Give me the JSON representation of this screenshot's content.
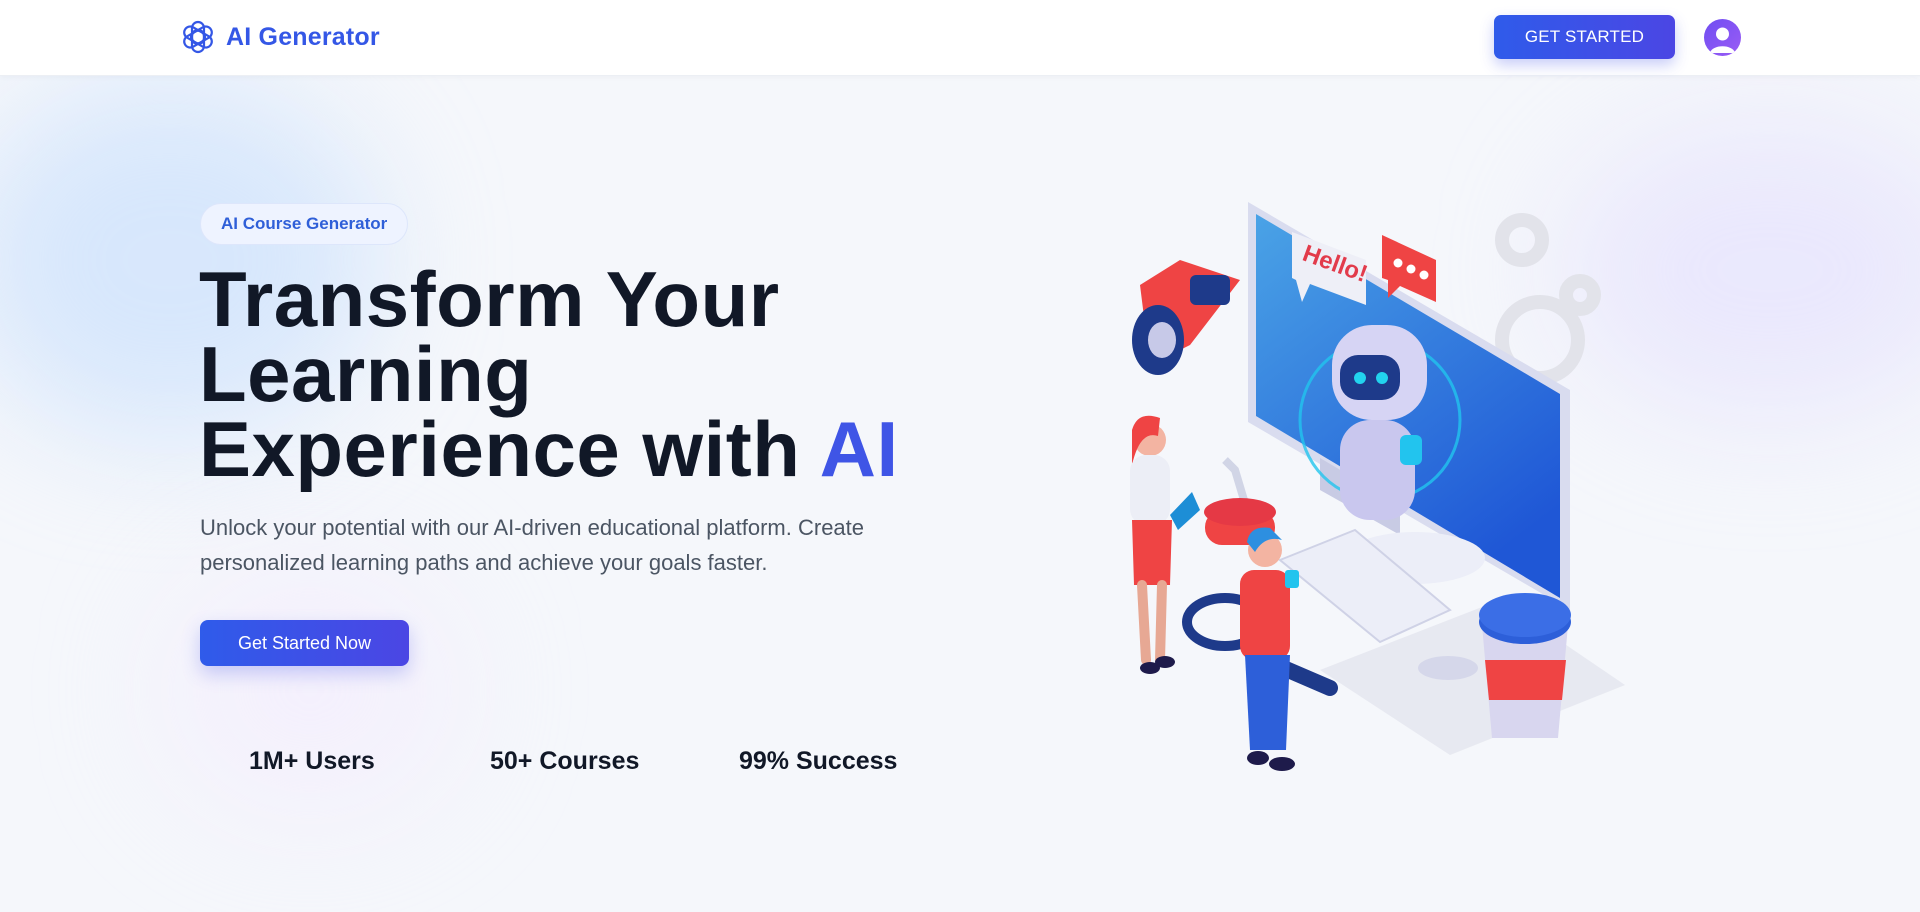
{
  "header": {
    "brand_name": "AI Generator",
    "brand_icon": "openai-knot-icon",
    "cta_label": "GET STARTED",
    "avatar_icon": "user-avatar-icon"
  },
  "hero": {
    "badge": "AI Course Generator",
    "headline_line1": "Transform Your",
    "headline_line2": "Learning",
    "headline_line3": "Experience with ",
    "headline_accent": "AI",
    "subtext": "Unlock your potential with our AI-driven educational platform. Create personalized learning paths and achieve your goals faster.",
    "cta_label": "Get Started Now"
  },
  "stats": [
    {
      "label": "1M+ Users"
    },
    {
      "label": "50+ Courses"
    },
    {
      "label": "99% Success"
    }
  ],
  "illustration": {
    "speech_bubble_text": "Hello!",
    "icon": "robot-learning-illustration"
  },
  "colors": {
    "brand": "#3457e6",
    "accent": "#3f55e6",
    "button_gradient_start": "#2f5bea",
    "button_gradient_end": "#4b46e4",
    "heading": "#111827",
    "body_text": "#4b5563"
  }
}
